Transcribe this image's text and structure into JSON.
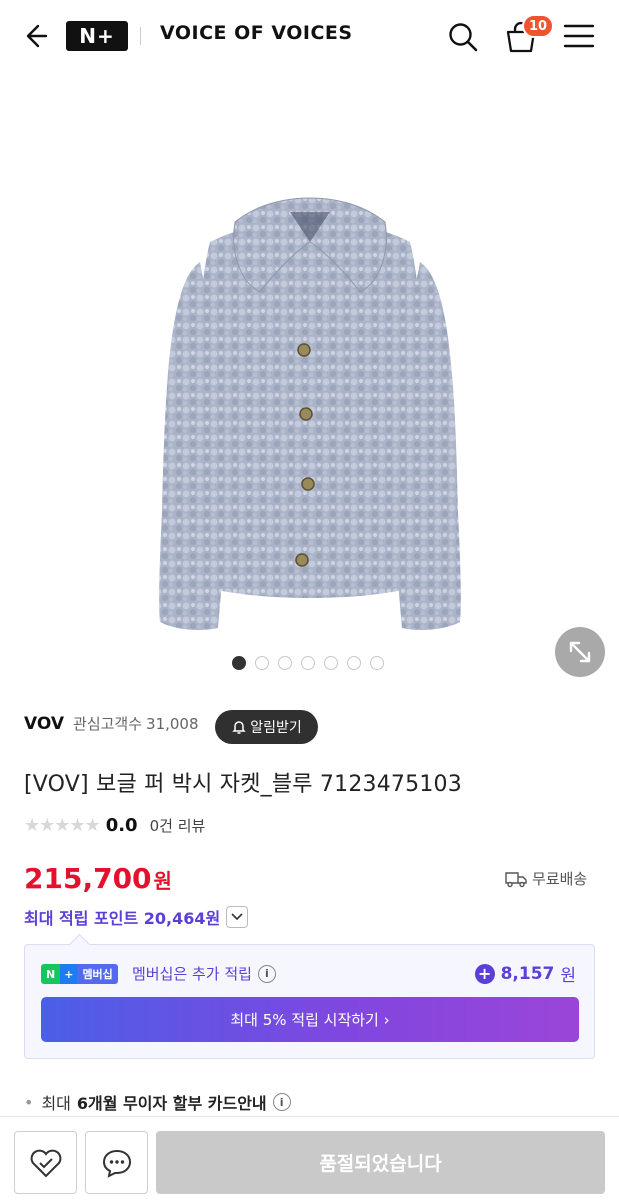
{
  "header": {
    "logo_text": "N+",
    "brand": "VOICE OF VOICES",
    "cart_count": "10"
  },
  "gallery": {
    "dot_count": 7,
    "active_index": 0
  },
  "seller": {
    "name": "VOV",
    "fans_label": "관심고객수",
    "fans_count": "31,008",
    "alert_label": "알림받기"
  },
  "product": {
    "title": "[VOV] 보글 퍼 박시 자켓_블루 7123475103",
    "stars": "★★★★★",
    "score": "0.0",
    "reviews": "0건 리뷰",
    "price": "215,700",
    "price_unit": "원",
    "shipping": "무료배송",
    "points_label": "최대 적립 포인트 20,464원"
  },
  "membership": {
    "badge_np": "N",
    "badge_plus": "+",
    "badge_mb": "멤버십",
    "text": "멤버십은 추가 적립",
    "points": "8,157",
    "points_unit": "원",
    "cta": "최대 5% 적립 시작하기 ›"
  },
  "installment": {
    "prefix": "최대",
    "bold": "6개월 무이자 할부 카드안내"
  },
  "bottom": {
    "soldout_label": "품절되었습니다"
  },
  "colors": {
    "price_red": "#e4112c",
    "points_purple": "#5c3fd4",
    "cart_badge": "#f0542f"
  }
}
